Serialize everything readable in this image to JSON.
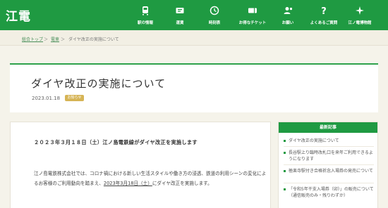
{
  "header": {
    "logo": "江電",
    "nav": [
      {
        "label": "駅の情報",
        "icon": "train-icon"
      },
      {
        "label": "運賃",
        "icon": "ticket-icon"
      },
      {
        "label": "時刻表",
        "icon": "clock-icon"
      },
      {
        "label": "お得なチケット",
        "icon": "tag-ticket-icon"
      },
      {
        "label": "お願い",
        "icon": "request-icon"
      },
      {
        "label": "よくあるご質問",
        "icon": "question-icon"
      },
      {
        "label": "江ノ電博物館",
        "icon": "sparkle-icon"
      }
    ]
  },
  "breadcrumb": {
    "home": "総合トップ",
    "sep1": "＞",
    "section": "電車",
    "sep2": "＞",
    "current": "ダイヤ改正の実施について"
  },
  "article": {
    "title": "ダイヤ改正の実施について",
    "date": "2023.01.18",
    "badge": "お知らせ",
    "lead": "２０２３年３月１８日（土）江ノ島電鉄線がダイヤ改正を実施します",
    "para_1": "江ノ島電鉄株式会社では、コロナ禍における新しい生活スタイルや働き方の浸透、鉄道の利用シーンの変化によるお客様のご利用動向を踏まえ、",
    "para_date": "2023年3月18日（土）",
    "para_2": "にダイヤ改正を実施します。"
  },
  "sidebar": {
    "heading": "最新記事",
    "items": [
      "ダイヤ改正の実施について",
      "長谷駅上り臨時改札口を来年ご利用できるようになります",
      "極楽寺駅付き合格祈念入場券の発売について",
      "「令和5年干支入場券（卯）」の販売について（通信販売のみ・残りわずか）"
    ]
  }
}
